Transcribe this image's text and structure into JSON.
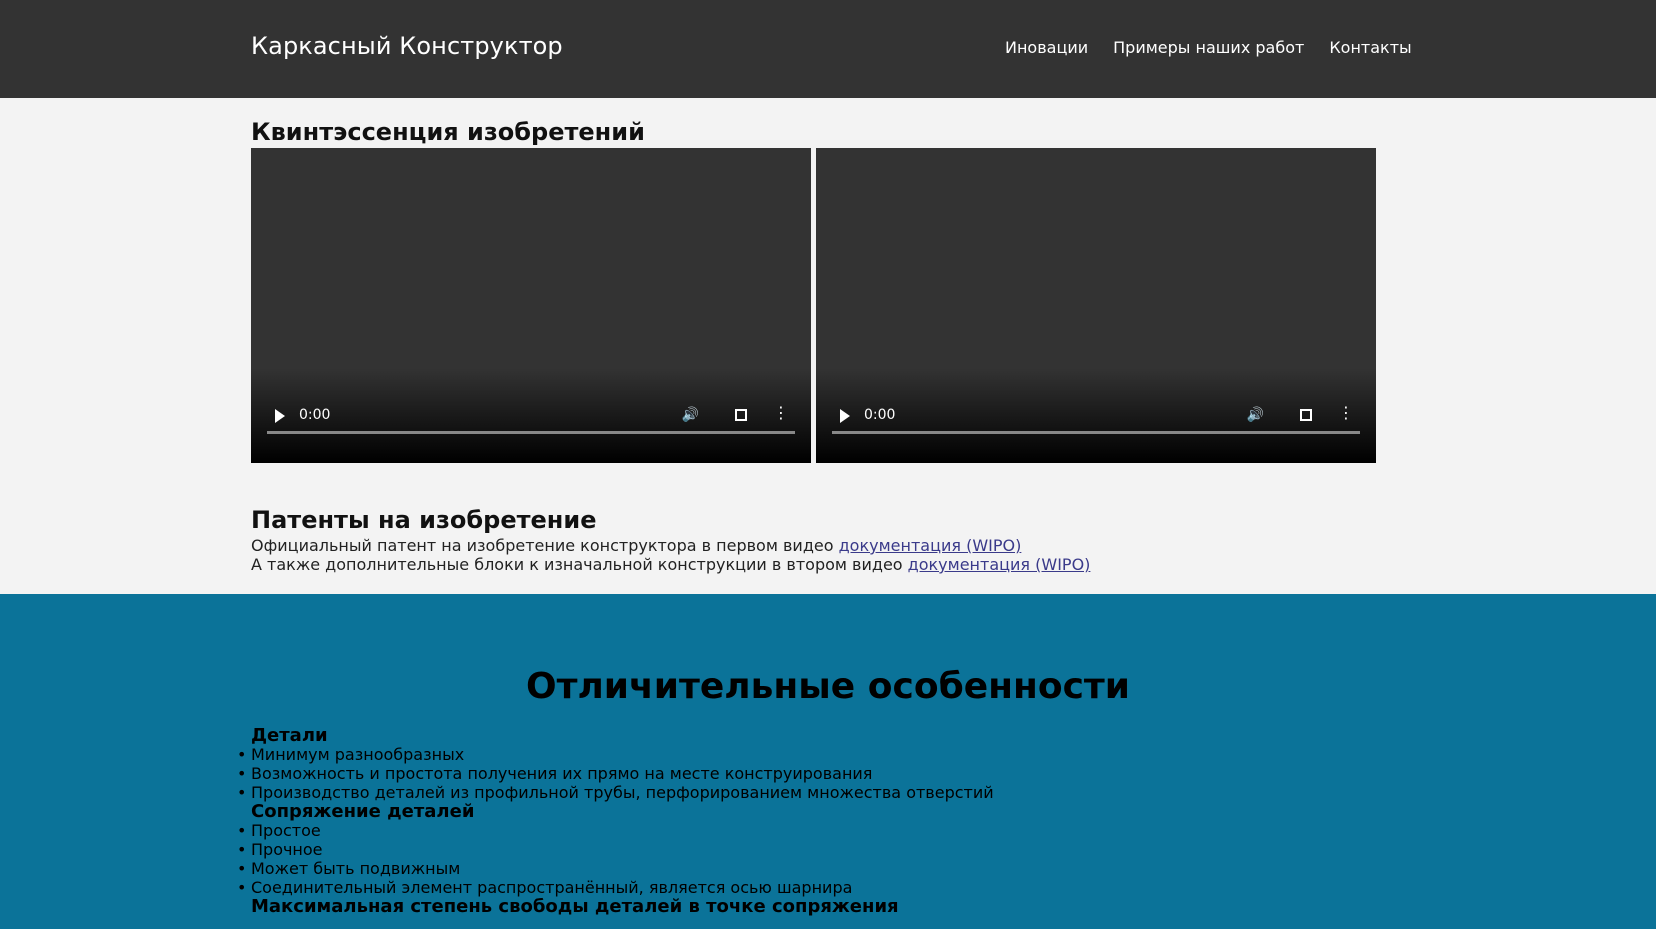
{
  "header": {
    "brand": "Каркасный Конструктор",
    "nav": [
      "Иновации",
      "Примеры наших работ",
      "Контакты"
    ]
  },
  "main": {
    "heading": "Квинтэссенция изобретений",
    "videos": [
      {
        "time": "0:00"
      },
      {
        "time": "0:00"
      }
    ],
    "patents_heading": "Патенты на изобретение",
    "patents": [
      {
        "text": "Официальный патент на изобретение конструктора в первом видео ",
        "link": "документация (WIPO)"
      },
      {
        "text": "А также дополнительные блоки к изначальной конструкции в втором видео ",
        "link": "документация (WIPO)"
      }
    ]
  },
  "features": {
    "title": "Отличительные особенности",
    "groups": [
      {
        "heading": "Детали",
        "items": [
          "Минимум разнообразных",
          "Возможность и простота получения их прямо на месте конструирования",
          "Производство деталей из профильной трубы, перфорированием множества отверстий"
        ]
      },
      {
        "heading": "Сопряжение деталей",
        "items": [
          "Простое",
          "Прочное",
          "Может быть подвижным",
          "Соединительный элемент распространённый, является осью шарнира"
        ]
      },
      {
        "heading": "Максимальная степень свободы деталей в точке сопряжения",
        "items": []
      }
    ]
  },
  "colors": {
    "header_bg": "#333333",
    "page_bg": "#f3f3f3",
    "features_bg": "#0b7399"
  }
}
